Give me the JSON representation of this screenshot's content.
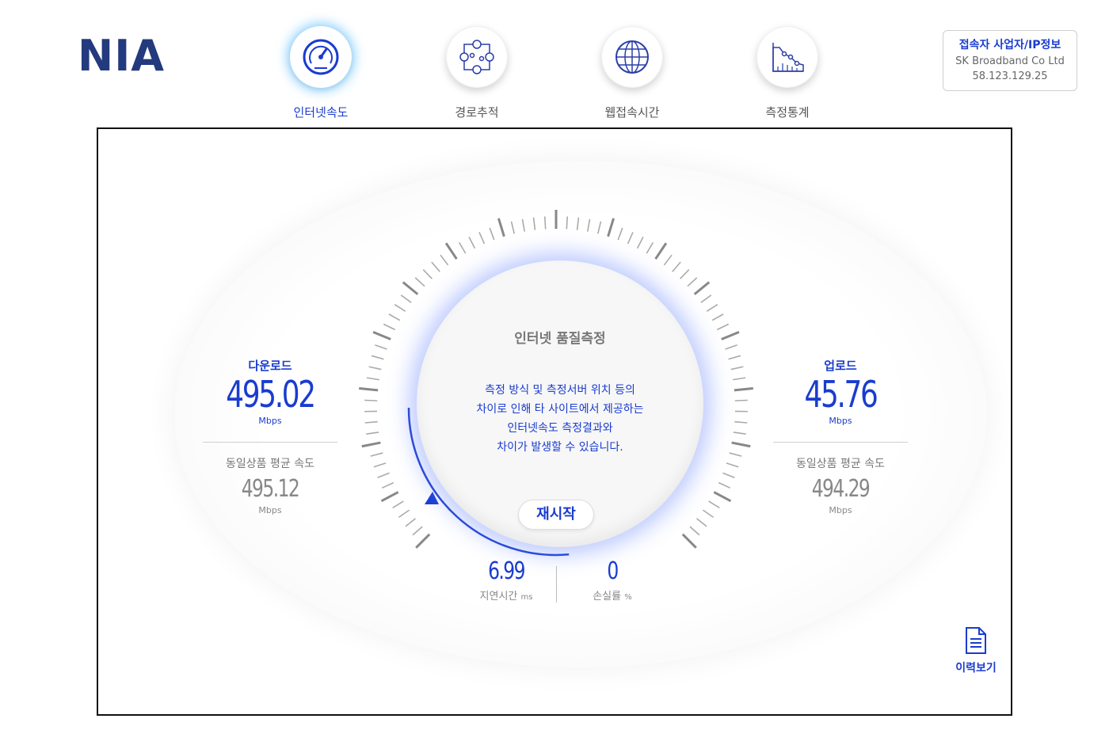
{
  "logo": "NIA",
  "nav": {
    "items": [
      {
        "label": "인터넷속도"
      },
      {
        "label": "경로추적"
      },
      {
        "label": "웹접속시간"
      },
      {
        "label": "측정통계"
      }
    ]
  },
  "ip_info": {
    "title": "접속자 사업자/IP정보",
    "isp": "SK Broadband Co Ltd",
    "ip": "58.123.129.25"
  },
  "download": {
    "title": "다운로드",
    "value": "495.02",
    "unit": "Mbps",
    "avg_label": "동일상품 평균 속도",
    "avg_value": "495.12",
    "avg_unit": "Mbps"
  },
  "upload": {
    "title": "업로드",
    "value": "45.76",
    "unit": "Mbps",
    "avg_label": "동일상품 평균 속도",
    "avg_value": "494.29",
    "avg_unit": "Mbps"
  },
  "center": {
    "title": "인터넷 품질측정",
    "msg1": "측정 방식 및 측정서버 위치 등의",
    "msg2": "차이로 인해 타 사이트에서 제공하는",
    "msg3": "인터넷속도 측정결과와",
    "msg4": "차이가 발생할 수 있습니다.",
    "restart_label": "재시작"
  },
  "latency": {
    "value": "6.99",
    "label": "지연시간",
    "unit": "ms"
  },
  "loss": {
    "value": "0",
    "label": "손실률",
    "unit": "%"
  },
  "history_label": "이력보기",
  "colors": {
    "accent": "#1a3ccf",
    "logo": "#233a7e"
  }
}
